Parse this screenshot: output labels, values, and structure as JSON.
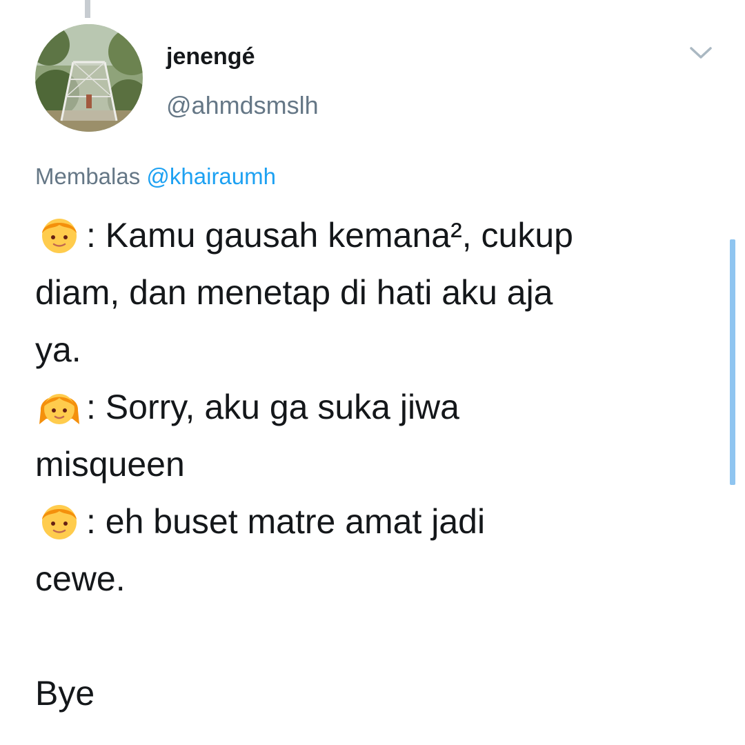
{
  "tweet": {
    "display_name": "jenengé",
    "handle": "@ahmdsmslh",
    "reply_prefix": "Membalas",
    "reply_mention": "@khairaumh",
    "lines": [
      ": Kamu gausah kemana², cukup",
      "diam, dan menetap di hati aku aja",
      "ya.",
      ": Sorry, aku ga suka jiwa",
      "misqueen",
      ": eh buset matre amat jadi",
      "cewe.",
      "Bye"
    ]
  },
  "icons": {
    "boy": "boy-emoji-icon",
    "girl": "girl-emoji-icon",
    "caret": "chevron-down-icon"
  },
  "colors": {
    "text": "#14171a",
    "secondary": "#657786",
    "link": "#1da1f2",
    "scrollbar": "#8fc5f0"
  }
}
